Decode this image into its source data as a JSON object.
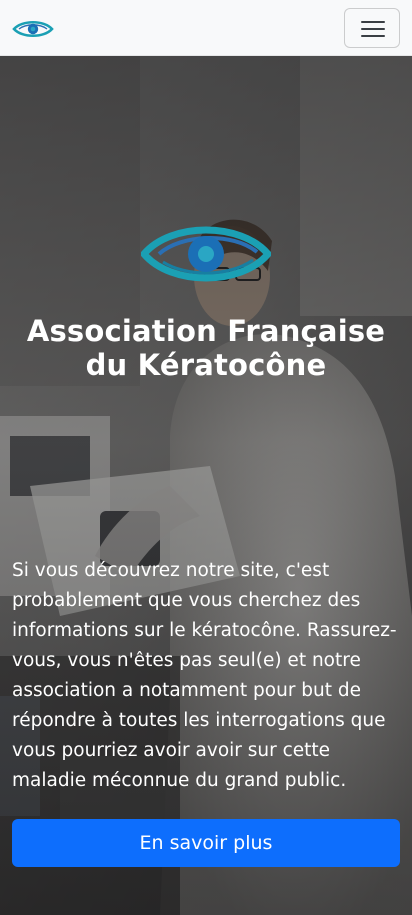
{
  "navbar": {
    "logo_icon": "eye-icon",
    "menu_icon": "hamburger-menu-icon"
  },
  "hero": {
    "logo_icon": "eye-icon",
    "title": "Association Française du Kératocône",
    "description": "Si vous découvrez notre site, c'est probablement que vous cherchez des informations sur le kératocône. Rassurez-vous, vous n'êtes pas seul(e) et notre association a notamment pour but de répondre à toutes les interrogations que vous pourriez avoir avoir sur cette maladie méconnue du grand public.",
    "cta_label": "En savoir plus"
  },
  "colors": {
    "navbar_bg": "#f8f9fa",
    "brand_teal": "#1ba0b4",
    "brand_blue": "#2a7fc8",
    "button_primary": "#0d6efd",
    "text_light": "#ffffff"
  }
}
